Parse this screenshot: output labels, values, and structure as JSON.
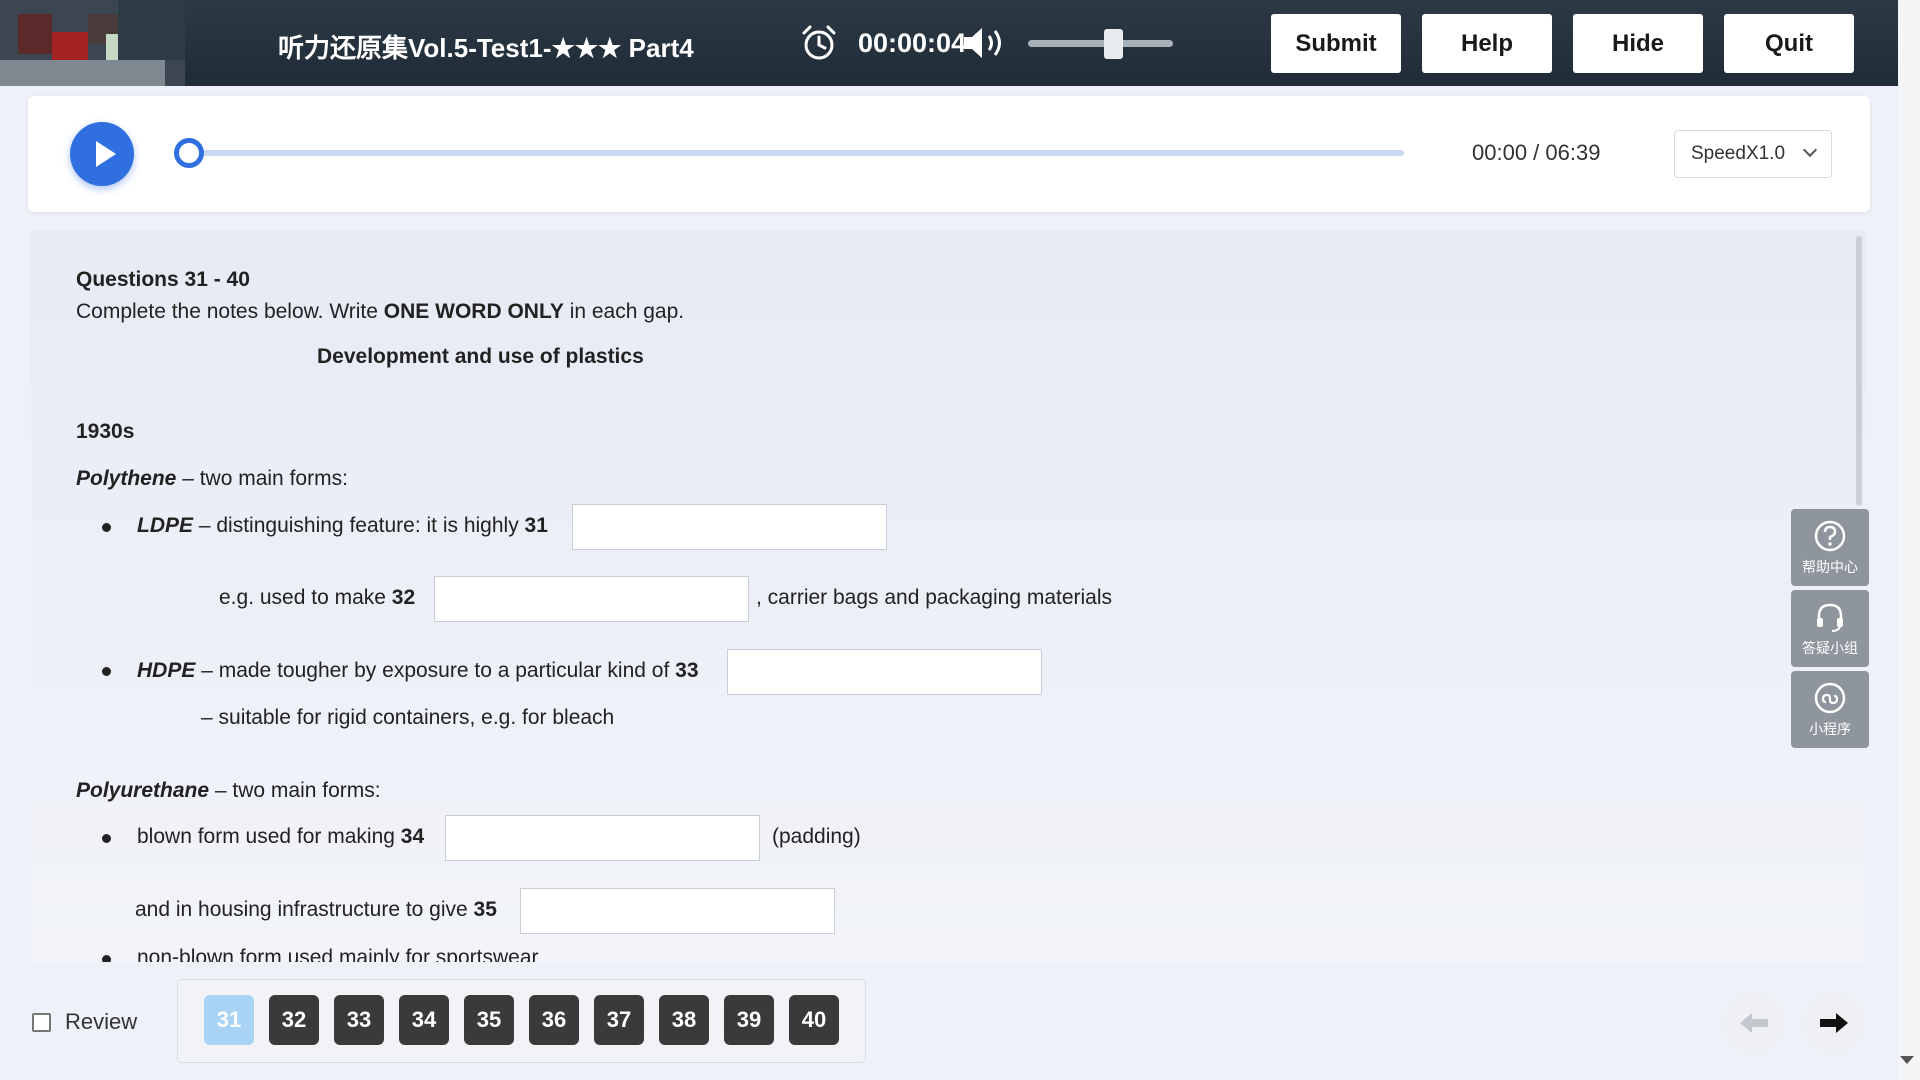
{
  "header": {
    "title": "听力还原集Vol.5-Test1-★★★ Part4",
    "timer": "00:00:04",
    "volume_level": 0.6,
    "buttons": {
      "submit": "Submit",
      "help": "Help",
      "hide": "Hide",
      "quit": "Quit"
    }
  },
  "player": {
    "time": "00:00 / 06:39",
    "progress": 0,
    "speed": "SpeedX1.0"
  },
  "content": {
    "heading": "Questions 31 - 40",
    "instruction_pre": "Complete the notes below. Write ",
    "instruction_bold": "ONE WORD ONLY",
    "instruction_post": " in each gap.",
    "notes_title": "Development and use of plastics",
    "section_1930s": "1930s",
    "polythene_name": "Polythene",
    "polythene_rest": " – two main forms:",
    "ldpe_name": "LDPE",
    "ldpe_text": " – distinguishing feature: it is highly ",
    "q31": "31",
    "eg_text": "e.g. used to make ",
    "q32": "32",
    "carrier_text": ", carrier bags and packaging materials",
    "hdpe_name": "HDPE",
    "hdpe_text": " – made tougher by exposure to a particular kind of ",
    "q33": "33",
    "rigid_text": "– suitable for rigid containers, e.g. for bleach",
    "polyurethane_name": "Polyurethane",
    "polyurethane_rest": " – two main forms:",
    "blown_text": "blown form used for making ",
    "q34": "34",
    "padding_text": "(padding)",
    "housing_text": "and in housing infrastructure to give ",
    "q35": "35",
    "nonblown_text": "non-blown form used mainly for sportswear"
  },
  "side_tools": [
    {
      "label": "帮助中心",
      "icon": "help-circle-icon"
    },
    {
      "label": "答疑小组",
      "icon": "headset-icon"
    },
    {
      "label": "小程序",
      "icon": "miniprogram-icon"
    }
  ],
  "footer": {
    "review_label": "Review",
    "questions": [
      "31",
      "32",
      "33",
      "34",
      "35",
      "36",
      "37",
      "38",
      "39",
      "40"
    ],
    "active_question": "31"
  },
  "colors": {
    "accent": "#2f6fe0",
    "topbar": "#25323d",
    "question_active": "#a9d3f5",
    "question_default": "#3a3a3a"
  }
}
